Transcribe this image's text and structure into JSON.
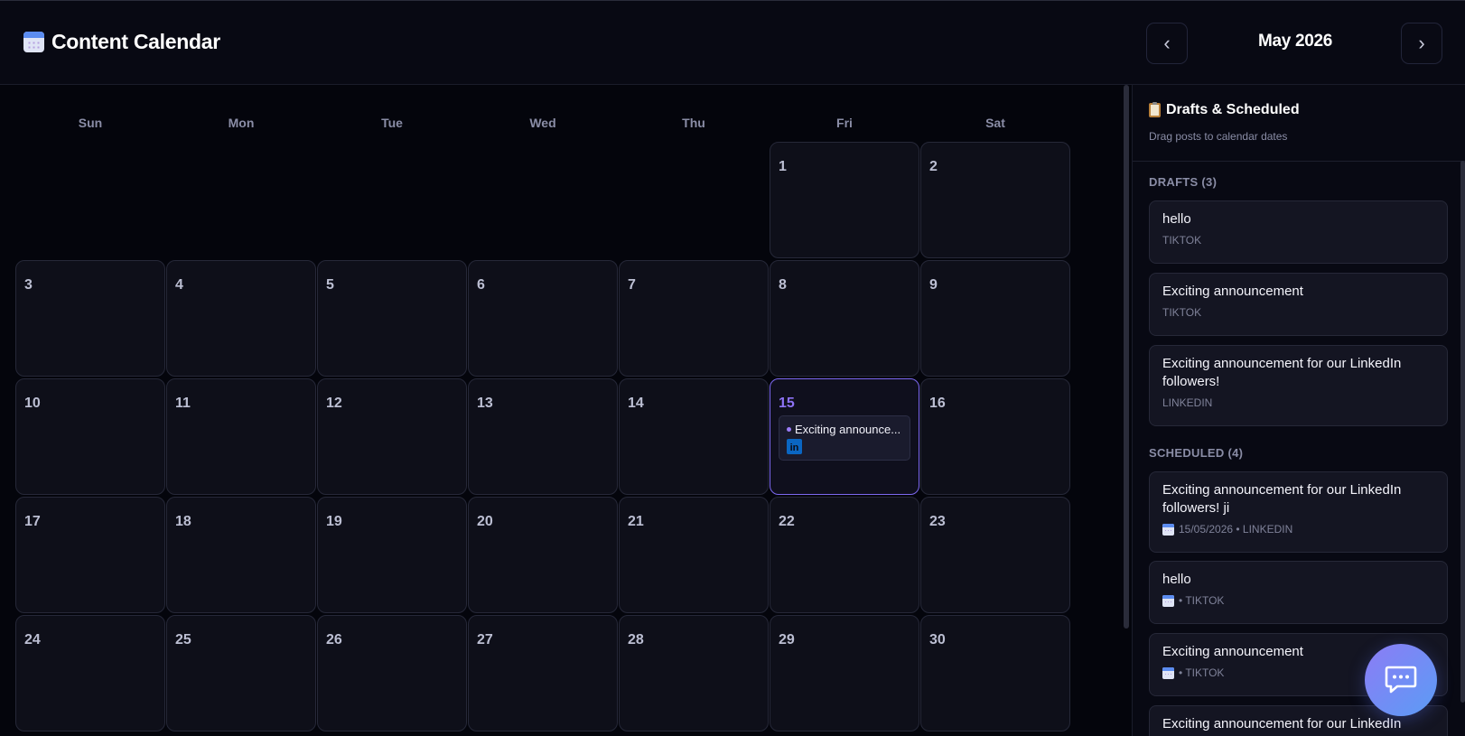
{
  "header": {
    "title": "Content Calendar",
    "month": "May 2026",
    "prev_label": "‹",
    "next_label": "›"
  },
  "calendar": {
    "weekdays": [
      "Sun",
      "Mon",
      "Tue",
      "Wed",
      "Thu",
      "Fri",
      "Sat"
    ],
    "today": "15",
    "days": [
      {
        "num": "1"
      },
      {
        "num": "2"
      },
      {
        "num": "3"
      },
      {
        "num": "4"
      },
      {
        "num": "5"
      },
      {
        "num": "6"
      },
      {
        "num": "7"
      },
      {
        "num": "8"
      },
      {
        "num": "9"
      },
      {
        "num": "10"
      },
      {
        "num": "11"
      },
      {
        "num": "12"
      },
      {
        "num": "13"
      },
      {
        "num": "14"
      },
      {
        "num": "15"
      },
      {
        "num": "16"
      },
      {
        "num": "17"
      },
      {
        "num": "18"
      },
      {
        "num": "19"
      },
      {
        "num": "20"
      },
      {
        "num": "21"
      },
      {
        "num": "22"
      },
      {
        "num": "23"
      },
      {
        "num": "24"
      },
      {
        "num": "25"
      },
      {
        "num": "26"
      },
      {
        "num": "27"
      },
      {
        "num": "28"
      },
      {
        "num": "29"
      },
      {
        "num": "30"
      }
    ],
    "event": {
      "day": "15",
      "text": "Exciting announce...",
      "platform_icon": "linkedin-icon",
      "icon_text": "in"
    }
  },
  "sidebar": {
    "title": "Drafts & Scheduled",
    "subtitle": "Drag posts to calendar dates",
    "drafts_label": "DRAFTS (3)",
    "drafts": [
      {
        "title": "hello",
        "meta": "TIKTOK"
      },
      {
        "title": "Exciting announcement",
        "meta": "TIKTOK"
      },
      {
        "title": "Exciting announcement for our LinkedIn followers!",
        "meta": "LINKEDIN"
      }
    ],
    "scheduled_label": "SCHEDULED (4)",
    "scheduled": [
      {
        "title": "Exciting announcement for our LinkedIn followers! ji",
        "meta": "15/05/2026 • LINKEDIN"
      },
      {
        "title": "hello",
        "meta": "• TIKTOK"
      },
      {
        "title": "Exciting announcement",
        "meta": "• TIKTOK"
      },
      {
        "title": "Exciting announcement for our LinkedIn",
        "meta": ""
      }
    ]
  },
  "colors": {
    "accent": "#7c68f0",
    "linkedin": "#0a66c2",
    "fab_start": "#8c7cf5",
    "fab_end": "#5b9cf5"
  }
}
